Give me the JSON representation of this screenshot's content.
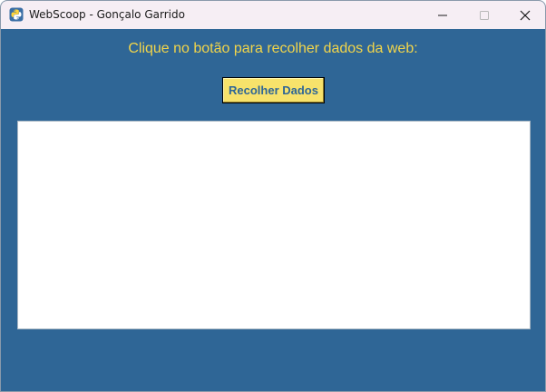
{
  "window": {
    "title": "WebScoop - Gonçalo Garrido",
    "icon": "python-icon",
    "controls": {
      "minimize_icon": "minimize-icon",
      "maximize_icon": "maximize-icon",
      "close_icon": "close-icon"
    }
  },
  "main": {
    "prompt": "Clique no botão para recolher dados da web:",
    "collect_button_label": "Recolher Dados",
    "output_text": ""
  },
  "colors": {
    "background": "#2f6696",
    "accent_text": "#f2d54a",
    "button_bg": "#f7e26b",
    "button_text": "#2f6696",
    "titlebar": "#f6eef4"
  }
}
